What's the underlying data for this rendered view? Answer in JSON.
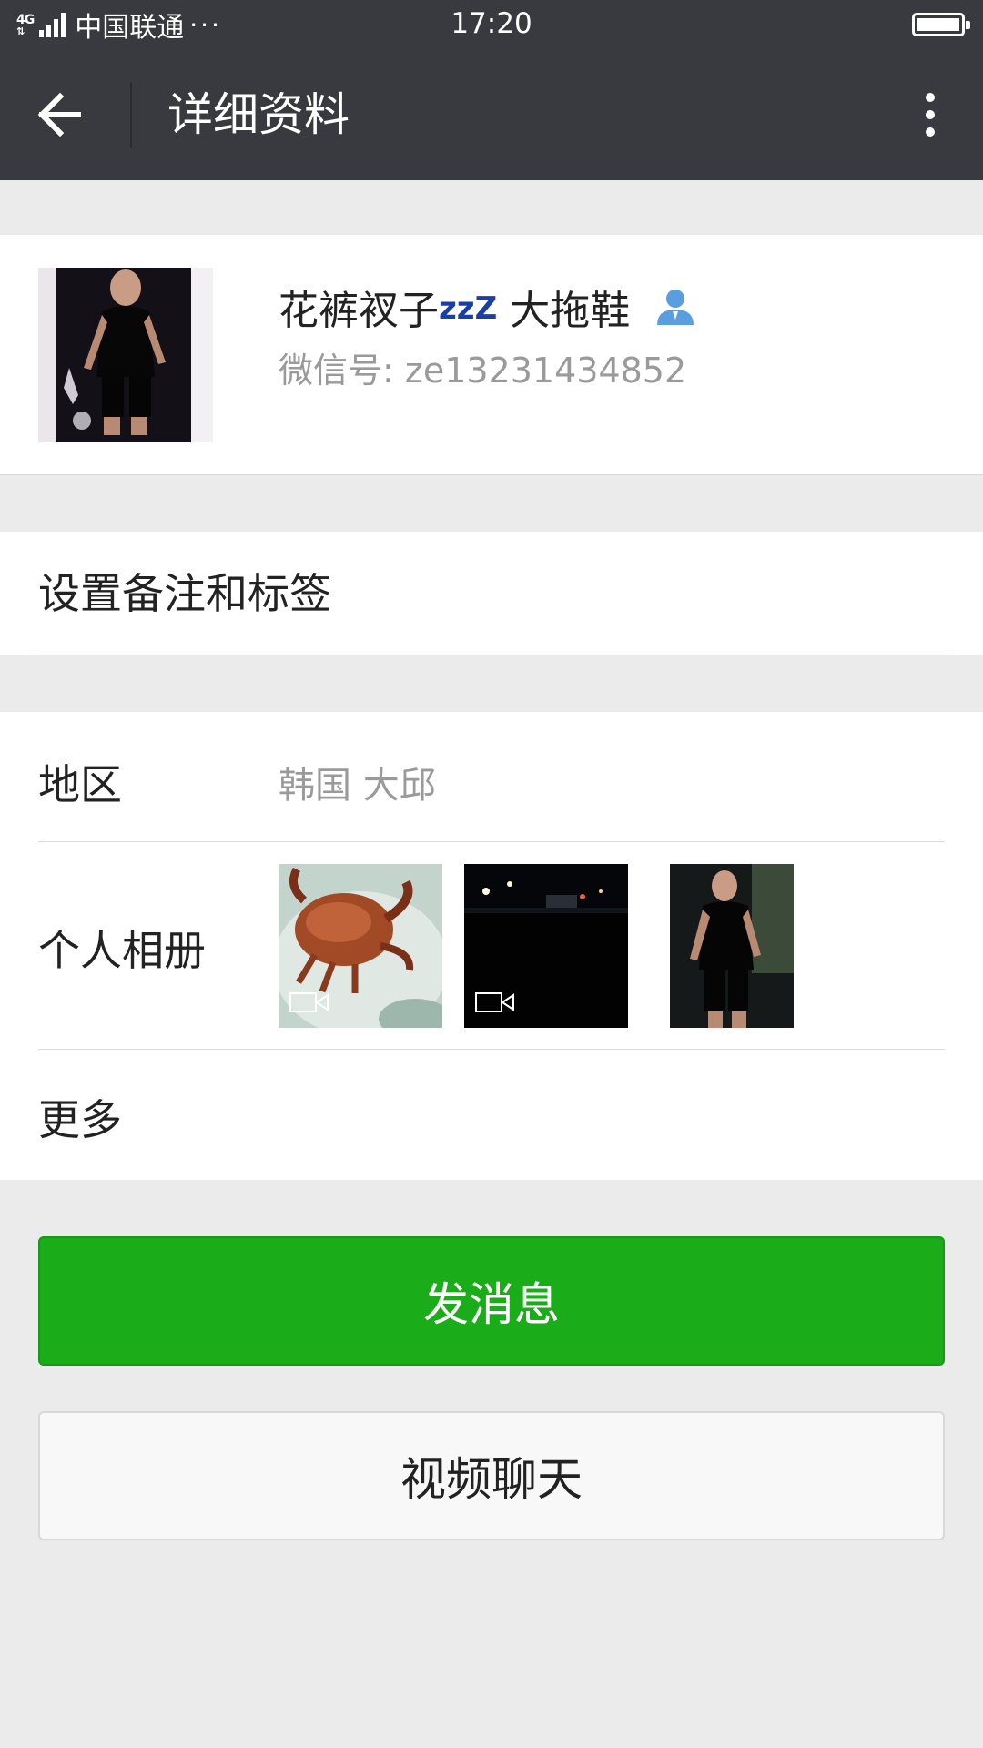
{
  "status_bar": {
    "network": "4G",
    "carrier": "中国联通",
    "more": "···",
    "time": "17:20"
  },
  "header": {
    "title": "详细资料",
    "back_icon": "arrow-left-icon",
    "menu_icon": "more-vertical-icon"
  },
  "profile": {
    "name_prefix": "花裤衩子",
    "name_sleep": "zzZ",
    "name_suffix": " 大拖鞋",
    "wechat_id": "微信号: ze13231434852",
    "contact_icon": "person-icon",
    "sleep_color": "#1a3fa8"
  },
  "remark": {
    "label": "设置备注和标签"
  },
  "info": {
    "region_label": "地区",
    "region_value": "韩国  大邱",
    "album_label": "个人相册",
    "more_label": "更多",
    "album_icons": [
      "crab-photo",
      "night-street-photo",
      "person-photo"
    ],
    "video_icon": "video-camera-icon"
  },
  "actions": {
    "send_message": "发消息",
    "video_chat": "视频聊天",
    "accent_color": "#1aad19"
  }
}
